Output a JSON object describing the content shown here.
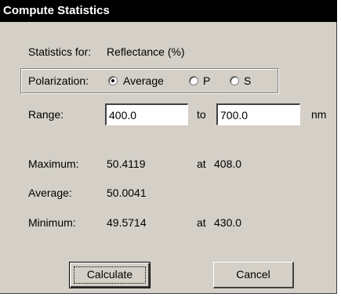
{
  "dialog": {
    "title": "Compute Statistics"
  },
  "statistics_for": {
    "label": "Statistics for:",
    "value": "Reflectance (%)"
  },
  "polarization": {
    "label": "Polarization:",
    "options": [
      {
        "label": "Average",
        "selected": true
      },
      {
        "label": "P",
        "selected": false
      },
      {
        "label": "S",
        "selected": false
      }
    ]
  },
  "range": {
    "label": "Range:",
    "from": "400.0",
    "to_label": "to",
    "to": "700.0",
    "unit": "nm"
  },
  "results": {
    "maximum": {
      "label": "Maximum:",
      "value": "50.4119",
      "at_label": "at",
      "at_value": "408.0"
    },
    "average": {
      "label": "Average:",
      "value": "50.0041"
    },
    "minimum": {
      "label": "Minimum:",
      "value": "49.5714",
      "at_label": "at",
      "at_value": "430.0"
    }
  },
  "buttons": {
    "calculate": "Calculate",
    "cancel": "Cancel"
  },
  "colors": {
    "dialog_background": "#d4d0c8",
    "titlebar_background": "#000000",
    "titlebar_text": "#ffffff"
  }
}
